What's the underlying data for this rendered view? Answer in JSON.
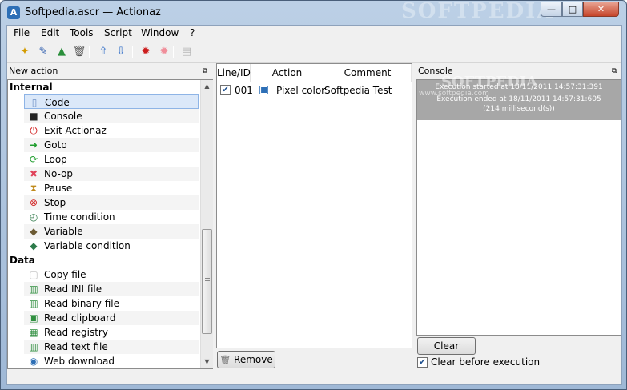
{
  "window": {
    "title": "Softpedia.ascr — Actionaz",
    "watermark": "SOFTPEDIA",
    "app_icon": "actionaz-icon",
    "min_label": "—",
    "max_label": "□",
    "close_label": "✕"
  },
  "menu": [
    "File",
    "Edit",
    "Tools",
    "Script",
    "Window",
    "?"
  ],
  "toolbar": [
    {
      "name": "new-icon",
      "glyph": "✦",
      "color": "#d39b00"
    },
    {
      "name": "wand-icon",
      "glyph": "✎",
      "color": "#3a66b2"
    },
    {
      "name": "blocks-icon",
      "glyph": "▲",
      "color": "#2a8f3b"
    },
    {
      "name": "trash-icon",
      "glyph": "🗑",
      "color": "#555555"
    },
    {
      "name": "arrow-up-icon",
      "glyph": "⇧",
      "color": "#2e6cc7"
    },
    {
      "name": "arrow-down-icon",
      "glyph": "⇩",
      "color": "#2e6cc7"
    },
    {
      "name": "gear-red-icon",
      "glyph": "✹",
      "color": "#cc1d1d"
    },
    {
      "name": "gear-pink-icon",
      "glyph": "✹",
      "color": "#f08e9a"
    },
    {
      "name": "document-icon",
      "glyph": "▤",
      "color": "#b8b8b8"
    }
  ],
  "left_panel": {
    "title": "New action",
    "float_icon": "⧉",
    "groups": [
      {
        "name": "Internal",
        "items": [
          {
            "label": "Code",
            "icon": "▯",
            "color": "#6d8fc4",
            "selected": true
          },
          {
            "label": "Console",
            "icon": "■",
            "color": "#222222"
          },
          {
            "label": "Exit Actionaz",
            "icon": "⏻",
            "color": "#d01b1b"
          },
          {
            "label": "Goto",
            "icon": "➜",
            "color": "#1f9d2d"
          },
          {
            "label": "Loop",
            "icon": "⟳",
            "color": "#1f9d2d"
          },
          {
            "label": "No-op",
            "icon": "✖",
            "color": "#e0435a"
          },
          {
            "label": "Pause",
            "icon": "⧗",
            "color": "#c08a1c"
          },
          {
            "label": "Stop",
            "icon": "⊗",
            "color": "#d01b1b"
          },
          {
            "label": "Time condition",
            "icon": "◴",
            "color": "#2f7a4a"
          },
          {
            "label": "Variable",
            "icon": "◆",
            "color": "#6b5a33"
          },
          {
            "label": "Variable condition",
            "icon": "◆",
            "color": "#2d7b4b"
          }
        ]
      },
      {
        "name": "Data",
        "items": [
          {
            "label": "Copy file",
            "icon": "▢",
            "color": "#bdbdbd"
          },
          {
            "label": "Read INI file",
            "icon": "▥",
            "color": "#2f8f3f"
          },
          {
            "label": "Read binary file",
            "icon": "▥",
            "color": "#2f8f3f"
          },
          {
            "label": "Read clipboard",
            "icon": "▣",
            "color": "#2f8f3f"
          },
          {
            "label": "Read registry",
            "icon": "▦",
            "color": "#2f8f3f"
          },
          {
            "label": "Read text file",
            "icon": "▥",
            "color": "#2f8f3f"
          },
          {
            "label": "Web download",
            "icon": "◉",
            "color": "#2d6fb6"
          }
        ]
      }
    ]
  },
  "script_table": {
    "headers": [
      "Line/ID",
      "Action",
      "Comment"
    ],
    "rows": [
      {
        "checked": true,
        "check_glyph": "✔",
        "id": "001",
        "icon": "▣",
        "action": "Pixel color",
        "comment": "Softpedia Test"
      }
    ],
    "remove_button": "Remove",
    "remove_icon": "🗑"
  },
  "console": {
    "title": "Console",
    "float_icon": "⧉",
    "watermark": "SOFTPEDIA",
    "watermark_url": "www.softpedia.com",
    "lines": [
      "Execution started at 18/11/2011 14:57:31:391",
      "Execution ended at 18/11/2011 14:57:31:605",
      "(214 millisecond(s))"
    ],
    "clear_button": "Clear",
    "clear_before_label": "Clear before execution",
    "clear_before_checked": true,
    "check_glyph": "✔"
  }
}
